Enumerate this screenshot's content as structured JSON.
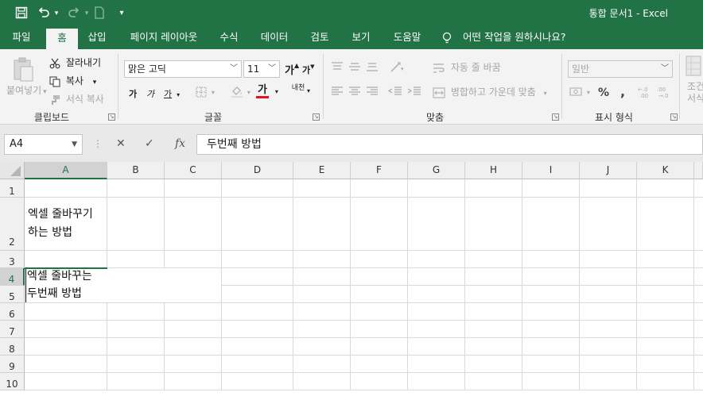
{
  "title_bar": {
    "window_title": "통합 문서1  -  Excel",
    "qat": [
      {
        "name": "save-icon",
        "glyph": "💾"
      },
      {
        "name": "undo-icon",
        "glyph": "↶"
      },
      {
        "name": "redo-icon",
        "glyph": "↷"
      },
      {
        "name": "new-file-icon",
        "glyph": "▢"
      },
      {
        "name": "customize-qat-icon",
        "glyph": "▾"
      }
    ]
  },
  "tabs": [
    "파일",
    "홈",
    "삽입",
    "페이지 레이아웃",
    "수식",
    "데이터",
    "검토",
    "보기",
    "도움말"
  ],
  "active_tab": "홈",
  "tell_me": "어떤 작업을 원하시나요?",
  "ribbon": {
    "clipboard": {
      "paste": "붙여넣기",
      "cut": "잘라내기",
      "copy": "복사",
      "format_painter": "서식 복사",
      "label": "클립보드"
    },
    "font": {
      "font_name": "맑은 고딕",
      "font_size": "11",
      "grow": "가",
      "shrink": "가",
      "bold": "가",
      "italic": "가",
      "underline": "가",
      "font_color_glyph": "가",
      "phonetic": "내천",
      "label": "글꼴"
    },
    "alignment": {
      "wrap_text": "자동 줄 바꿈",
      "merge_center": "병합하고 가운데 맞춤",
      "label": "맞춤"
    },
    "number": {
      "format": "일반",
      "percent": "%",
      "comma": ",",
      "label": "표시 형식"
    },
    "styles": {
      "conditional_line1": "조건",
      "conditional_line2": "서식"
    }
  },
  "formula_bar": {
    "name_box": "A4",
    "cancel": "✕",
    "enter": "✓",
    "fx": "fx",
    "formula": "두번째 방법"
  },
  "sheet": {
    "columns": [
      "A",
      "B",
      "C",
      "D",
      "E",
      "F",
      "G",
      "H",
      "I",
      "J",
      "K"
    ],
    "selected_column": "A",
    "rows": [
      "1",
      "2",
      "3",
      "4",
      "5",
      "6",
      "7",
      "8",
      "9",
      "10"
    ],
    "selected_row": "4",
    "cells": {
      "A2_line1": "엑셀 줄바꾸기",
      "A2_line2": "하는 방법",
      "A4_line1": "엑셀 줄바꾸는",
      "A4_line2": "두번째 방법"
    }
  },
  "colors": {
    "accent": "#217346",
    "font_color_bar": "#e81123"
  }
}
